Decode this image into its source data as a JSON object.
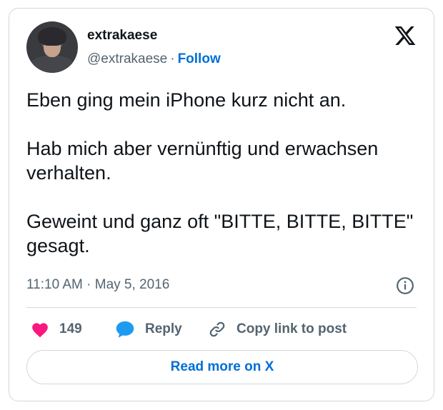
{
  "author": {
    "name": "extrakaese",
    "handle": "@extrakaese",
    "separator": "·",
    "follow_label": "Follow"
  },
  "tweet": {
    "lines": [
      "Eben ging mein iPhone kurz nicht an.",
      "Hab mich aber vernünftig und erwachsen verhalten.",
      "Geweint und ganz oft \"BITTE, BITTE, BITTE\" gesagt."
    ],
    "timestamp": "11:10 AM · May 5, 2016"
  },
  "actions": {
    "like_count": "149",
    "reply_label": "Reply",
    "copy_label": "Copy link to post"
  },
  "read_more_label": "Read more on X",
  "colors": {
    "link": "#006fd6",
    "heart": "#f91880",
    "reply_bubble": "#1d9bf0",
    "muted": "#536471",
    "border": "#cfd9de"
  },
  "icons": [
    "x-logo-icon",
    "info-icon",
    "heart-icon",
    "reply-bubble-icon",
    "link-icon"
  ]
}
